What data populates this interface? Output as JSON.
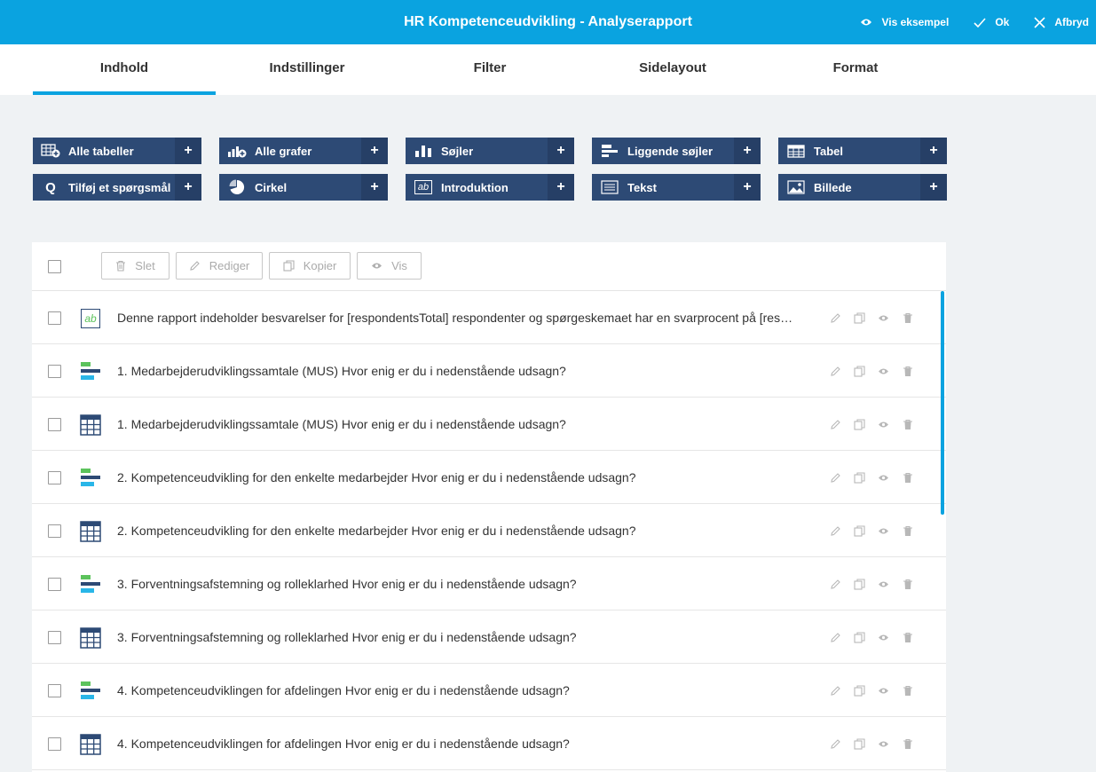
{
  "header": {
    "title": "HR Kompetenceudvikling - Analyserapport",
    "preview_label": "Vis eksempel",
    "ok_label": "Ok",
    "cancel_label": "Afbryd"
  },
  "tabs": [
    {
      "label": "Indhold",
      "active": true
    },
    {
      "label": "Indstillinger"
    },
    {
      "label": "Filter"
    },
    {
      "label": "Sidelayout"
    },
    {
      "label": "Format"
    }
  ],
  "add_buttons": [
    {
      "label": "Alle tabeller",
      "icon": "all-tables-icon"
    },
    {
      "label": "Alle grafer",
      "icon": "all-charts-icon"
    },
    {
      "label": "Søjler",
      "icon": "columns-icon"
    },
    {
      "label": "Liggende søjler",
      "icon": "horizontal-bars-icon"
    },
    {
      "label": "Tabel",
      "icon": "table-icon"
    },
    {
      "label": "Tilføj et spørgsmål",
      "icon": "question-icon",
      "glyph": "Q"
    },
    {
      "label": "Cirkel",
      "icon": "pie-icon"
    },
    {
      "label": "Introduktion",
      "icon": "intro-text-icon",
      "glyph": "ab"
    },
    {
      "label": "Tekst",
      "icon": "text-icon"
    },
    {
      "label": "Billede",
      "icon": "image-icon"
    }
  ],
  "plus_glyph": "+",
  "toolbar": {
    "delete_label": "Slet",
    "edit_label": "Rediger",
    "copy_label": "Kopier",
    "view_label": "Vis"
  },
  "rows": [
    {
      "type": "intro",
      "glyph": "ab",
      "text": "Denne rapport indeholder besvarelser for [respondentsTotal] respondenter og spørgeskemaet har en svarprocent på [respondentsPercent]."
    },
    {
      "type": "bars",
      "text": "1. Medarbejderudviklingssamtale (MUS) Hvor enig er du i nedenstående udsagn?"
    },
    {
      "type": "table",
      "text": "1. Medarbejderudviklingssamtale (MUS) Hvor enig er du i nedenstående udsagn?"
    },
    {
      "type": "bars",
      "text": "2. Kompetenceudvikling for den enkelte medarbejder Hvor enig er du i nedenstående udsagn?"
    },
    {
      "type": "table",
      "text": "2. Kompetenceudvikling for den enkelte medarbejder Hvor enig er du i nedenstående udsagn?"
    },
    {
      "type": "bars",
      "text": "3. Forventningsafstemning og rolleklarhed Hvor enig er du i nedenstående udsagn?"
    },
    {
      "type": "table",
      "text": "3. Forventningsafstemning og rolleklarhed Hvor enig er du i nedenstående udsagn?"
    },
    {
      "type": "bars",
      "text": "4. Kompetenceudviklingen for afdelingen Hvor enig er du i nedenstående udsagn?"
    },
    {
      "type": "table",
      "text": "4. Kompetenceudviklingen for afdelingen Hvor enig er du i nedenstående udsagn?"
    }
  ],
  "colors": {
    "topbar": "#0aa3e0",
    "button": "#2d4a75",
    "bar_green": "#5cc35c",
    "bar_navy": "#2d4a75",
    "bar_cyan": "#29b6e8"
  }
}
